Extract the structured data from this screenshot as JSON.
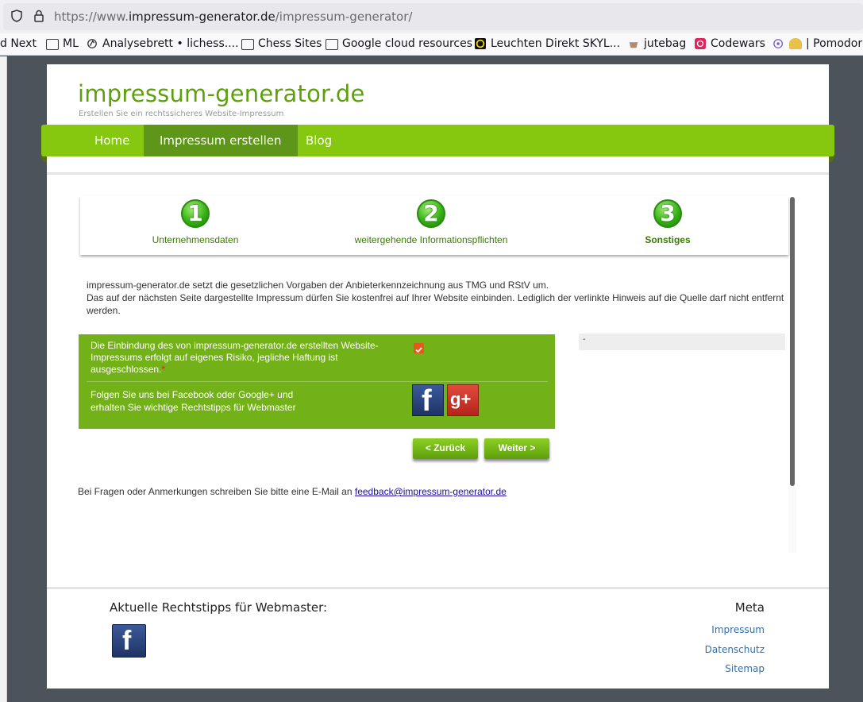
{
  "browser": {
    "url_prefix": "https://www.",
    "url_domain": "impressum-generator.de",
    "url_path": "/impressum-generator/",
    "bookmarks": [
      {
        "label": "d Next",
        "icon": "none"
      },
      {
        "label": "ML",
        "icon": "folder-icon"
      },
      {
        "label": "Analysebrett • lichess....",
        "icon": "lichess-icon"
      },
      {
        "label": "Chess Sites",
        "icon": "folder-icon"
      },
      {
        "label": "Google cloud resources",
        "icon": "folder-icon"
      },
      {
        "label": "Leuchten Direkt SKYL...",
        "icon": "leuchten-icon"
      },
      {
        "label": "jutebag",
        "icon": "jutebag-icon"
      },
      {
        "label": "Codewars",
        "icon": "codewars-icon"
      },
      {
        "label": "| Pomodor",
        "icon": "pomodoro-icon"
      }
    ]
  },
  "site": {
    "logo": "impressum-generator.de",
    "tagline": "Erstellen Sie ein rechtssicheres Website-Impressum",
    "nav": [
      {
        "label": "Home",
        "active": false
      },
      {
        "label": "Impressum erstellen",
        "active": true
      },
      {
        "label": "Blog",
        "active": false
      }
    ]
  },
  "steps": [
    {
      "number": "1",
      "label": "Unternehmensdaten",
      "current": false
    },
    {
      "number": "2",
      "label": "weitergehende Informationspflichten",
      "current": false
    },
    {
      "number": "3",
      "label": "Sonstiges",
      "current": true
    }
  ],
  "intro": {
    "line1": "impressum-generator.de setzt die gesetzlichen Vorgaben der Anbieterkennzeichnung aus TMG und RStV um.",
    "line2": "Das auf der nächsten Seite dargestellte Impressum dürfen Sie kostenfrei auf Ihrer Website einbinden. Lediglich der verlinkte Hinweis auf die Quelle darf nicht entfernt werden."
  },
  "form": {
    "disclaimer_text": "Die Einbindung des von impressum-generator.de erstellten Website-Impressums erfolgt auf eigenes Risiko, jegliche Haftung ist ausgeschlossen.",
    "required_mark": "*",
    "disclaimer_checked": true,
    "follow_text": "Folgen Sie uns bei Facebook oder Google+ und erhalten Sie wichtige Rechtstipps für Webmaster",
    "facebook_glyph": "f",
    "googleplus_glyph": "g+",
    "side_box_text": "-",
    "back_label": "< Zurück",
    "next_label": "Weiter >"
  },
  "contact": {
    "text": "Bei Fragen oder Anmerkungen schreiben Sie bitte eine E-Mail an ",
    "email": "feedback@impressum-generator.de"
  },
  "footer": {
    "tips_title": "Aktuelle Rechtstipps für Webmaster:",
    "facebook_glyph": "f",
    "meta_title": "Meta",
    "meta_links": [
      "Impressum",
      "Datenschutz",
      "Sitemap"
    ]
  },
  "colors": {
    "brand_green": "#86c80f",
    "active_nav": "#5e9619",
    "form_green": "#73b118",
    "checkbox": "#e8581c",
    "link_blue": "#2a6fb5"
  }
}
